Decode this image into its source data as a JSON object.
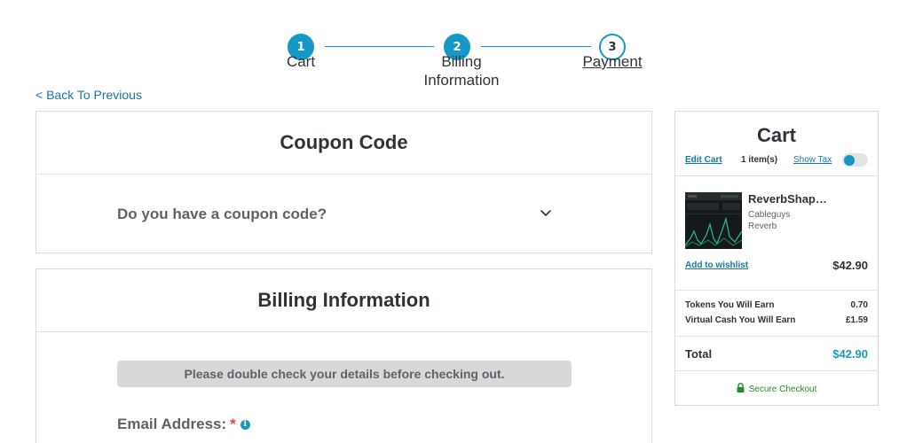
{
  "stepper": {
    "steps": [
      {
        "number": "1",
        "label": "Cart",
        "state": "done"
      },
      {
        "number": "2",
        "label_line1": "Billing",
        "label_line2": "Information",
        "state": "done"
      },
      {
        "number": "3",
        "label": "Payment",
        "state": "current"
      }
    ]
  },
  "nav": {
    "back_label": "< Back To Previous"
  },
  "coupon": {
    "title": "Coupon Code",
    "question": "Do you have a coupon code?",
    "icon": "chevron-down-icon"
  },
  "billing": {
    "title": "Billing Information",
    "notice": "Please double check your details before checking out.",
    "email_label": "Email Address:",
    "required_mark": "*",
    "info_icon": "i"
  },
  "cart": {
    "title": "Cart",
    "edit_label": "Edit Cart",
    "item_count": "1 item(s)",
    "show_tax_label": "Show Tax",
    "show_tax_enabled": false,
    "item": {
      "name": "ReverbShap…",
      "brand": "Cableguys",
      "category": "Reverb",
      "wishlist_label": "Add to wishlist",
      "price": "$42.90"
    },
    "earnings": [
      {
        "label": "Tokens You Will Earn",
        "value": "0.70"
      },
      {
        "label": "Virtual Cash You Will Earn",
        "value": "£1.59"
      }
    ],
    "total_label": "Total",
    "total_value": "$42.90",
    "secure_label": "Secure Checkout"
  },
  "colors": {
    "accent": "#1597c7",
    "link": "#1478a8",
    "text": "#2e3338",
    "muted": "#5f6368",
    "secure": "#2a8a2a",
    "required": "#e04141"
  }
}
